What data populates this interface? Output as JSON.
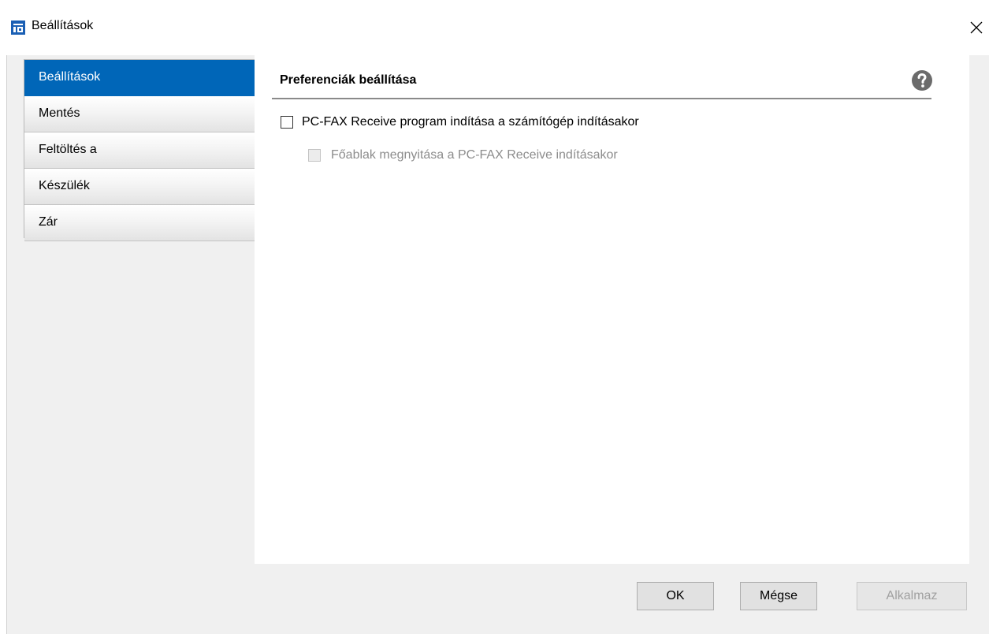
{
  "window": {
    "title": "Beállítások",
    "icon": "app-icon",
    "close_icon": "close-icon"
  },
  "sidebar": {
    "items": [
      {
        "label": "Beállítások",
        "selected": true
      },
      {
        "label": "Mentés",
        "selected": false
      },
      {
        "label": "Feltöltés a",
        "selected": false
      },
      {
        "label": "Készülék",
        "selected": false
      },
      {
        "label": "Zár",
        "selected": false
      }
    ]
  },
  "panel": {
    "title": "Preferenciák beállítása",
    "help_icon": "help-icon",
    "options": [
      {
        "label": "PC-FAX Receive program indítása a számítógép indításakor",
        "checked": false,
        "enabled": true
      },
      {
        "label": "Főablak megnyitása a PC-FAX Receive indításakor",
        "checked": false,
        "enabled": false
      }
    ]
  },
  "buttons": {
    "ok": "OK",
    "cancel": "Mégse",
    "apply": "Alkalmaz"
  },
  "colors": {
    "selected_bg": "#0066b8",
    "dialog_bg": "#f0f0f0",
    "panel_bg": "#ffffff"
  }
}
